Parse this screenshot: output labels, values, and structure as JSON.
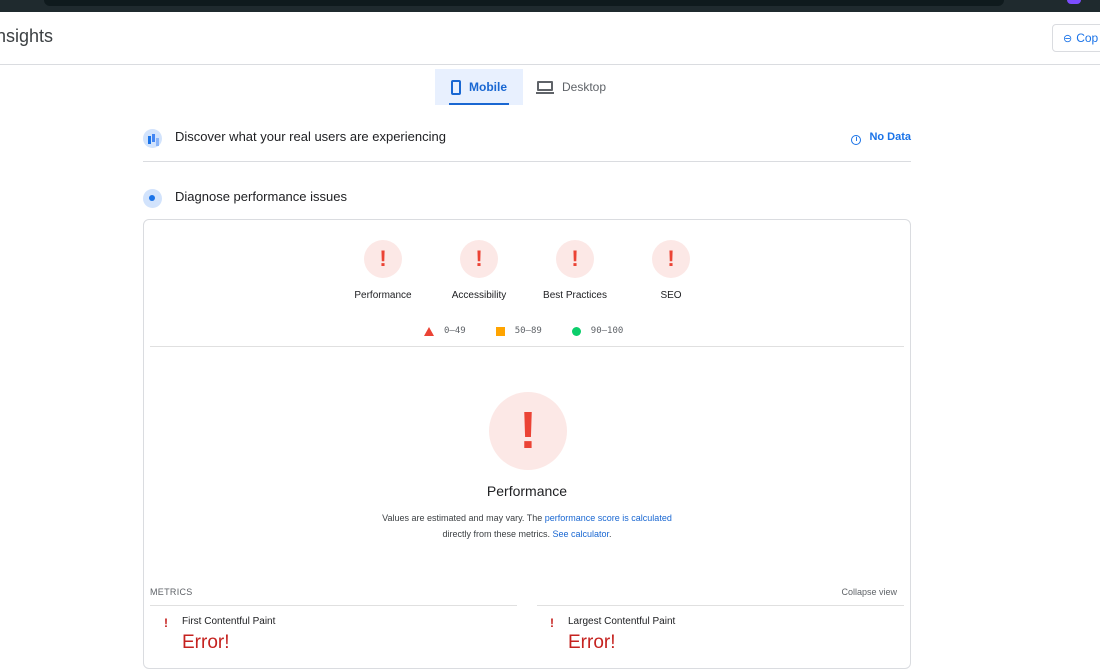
{
  "header": {
    "title": "nsights",
    "copy_label": "Cop"
  },
  "tabs": [
    {
      "label": "Mobile"
    },
    {
      "label": "Desktop"
    }
  ],
  "real_users": {
    "text": "Discover what your real users are experiencing",
    "status": "No Data"
  },
  "diagnose": {
    "text": "Diagnose performance issues"
  },
  "categories": [
    {
      "label": "Performance",
      "symbol": "!"
    },
    {
      "label": "Accessibility",
      "symbol": "!"
    },
    {
      "label": "Best Practices",
      "symbol": "!"
    },
    {
      "label": "SEO",
      "symbol": "!"
    }
  ],
  "legend": [
    {
      "range": "0–49",
      "shape": "triangle",
      "color": "#eb4335"
    },
    {
      "range": "50–89",
      "shape": "square",
      "color": "#ffa400"
    },
    {
      "range": "90–100",
      "shape": "circle",
      "color": "#0cce6b"
    }
  ],
  "performance": {
    "symbol": "!",
    "title": "Performance",
    "note_pre": "Values are estimated and may vary. The ",
    "note_link1": "performance score is calculated",
    "note_mid": "directly from these metrics. ",
    "note_link2": "See calculator",
    "note_end": "."
  },
  "metrics": {
    "heading": "METRICS",
    "collapse_label": "Collapse view",
    "items": [
      {
        "name": "First Contentful Paint",
        "value": "Error!"
      },
      {
        "name": "Largest Contentful Paint",
        "value": "Error!"
      }
    ]
  },
  "colors": {
    "accent": "#1967d2",
    "fail": "#eb4335",
    "fail_bg": "#fce8e6"
  }
}
